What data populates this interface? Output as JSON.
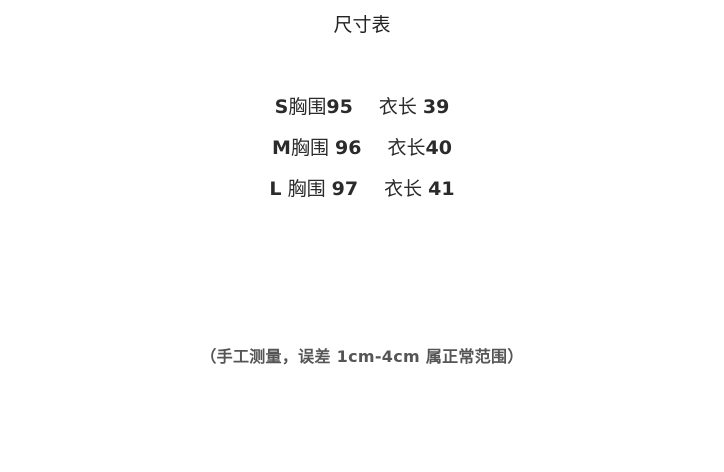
{
  "title": "尺寸表",
  "rows": [
    {
      "size": "S",
      "chest_label": "胸围",
      "chest": "95",
      "length_label": "衣长",
      "length": "39"
    },
    {
      "size": "M",
      "chest_label": "胸围",
      "chest": "96",
      "length_label": "衣长",
      "length": "40"
    },
    {
      "size": "L",
      "chest_label": "胸围",
      "chest": "97",
      "length_label": "衣长",
      "length": "41"
    }
  ],
  "note": "（手工测量，误差 1cm-4cm 属正常范围）"
}
